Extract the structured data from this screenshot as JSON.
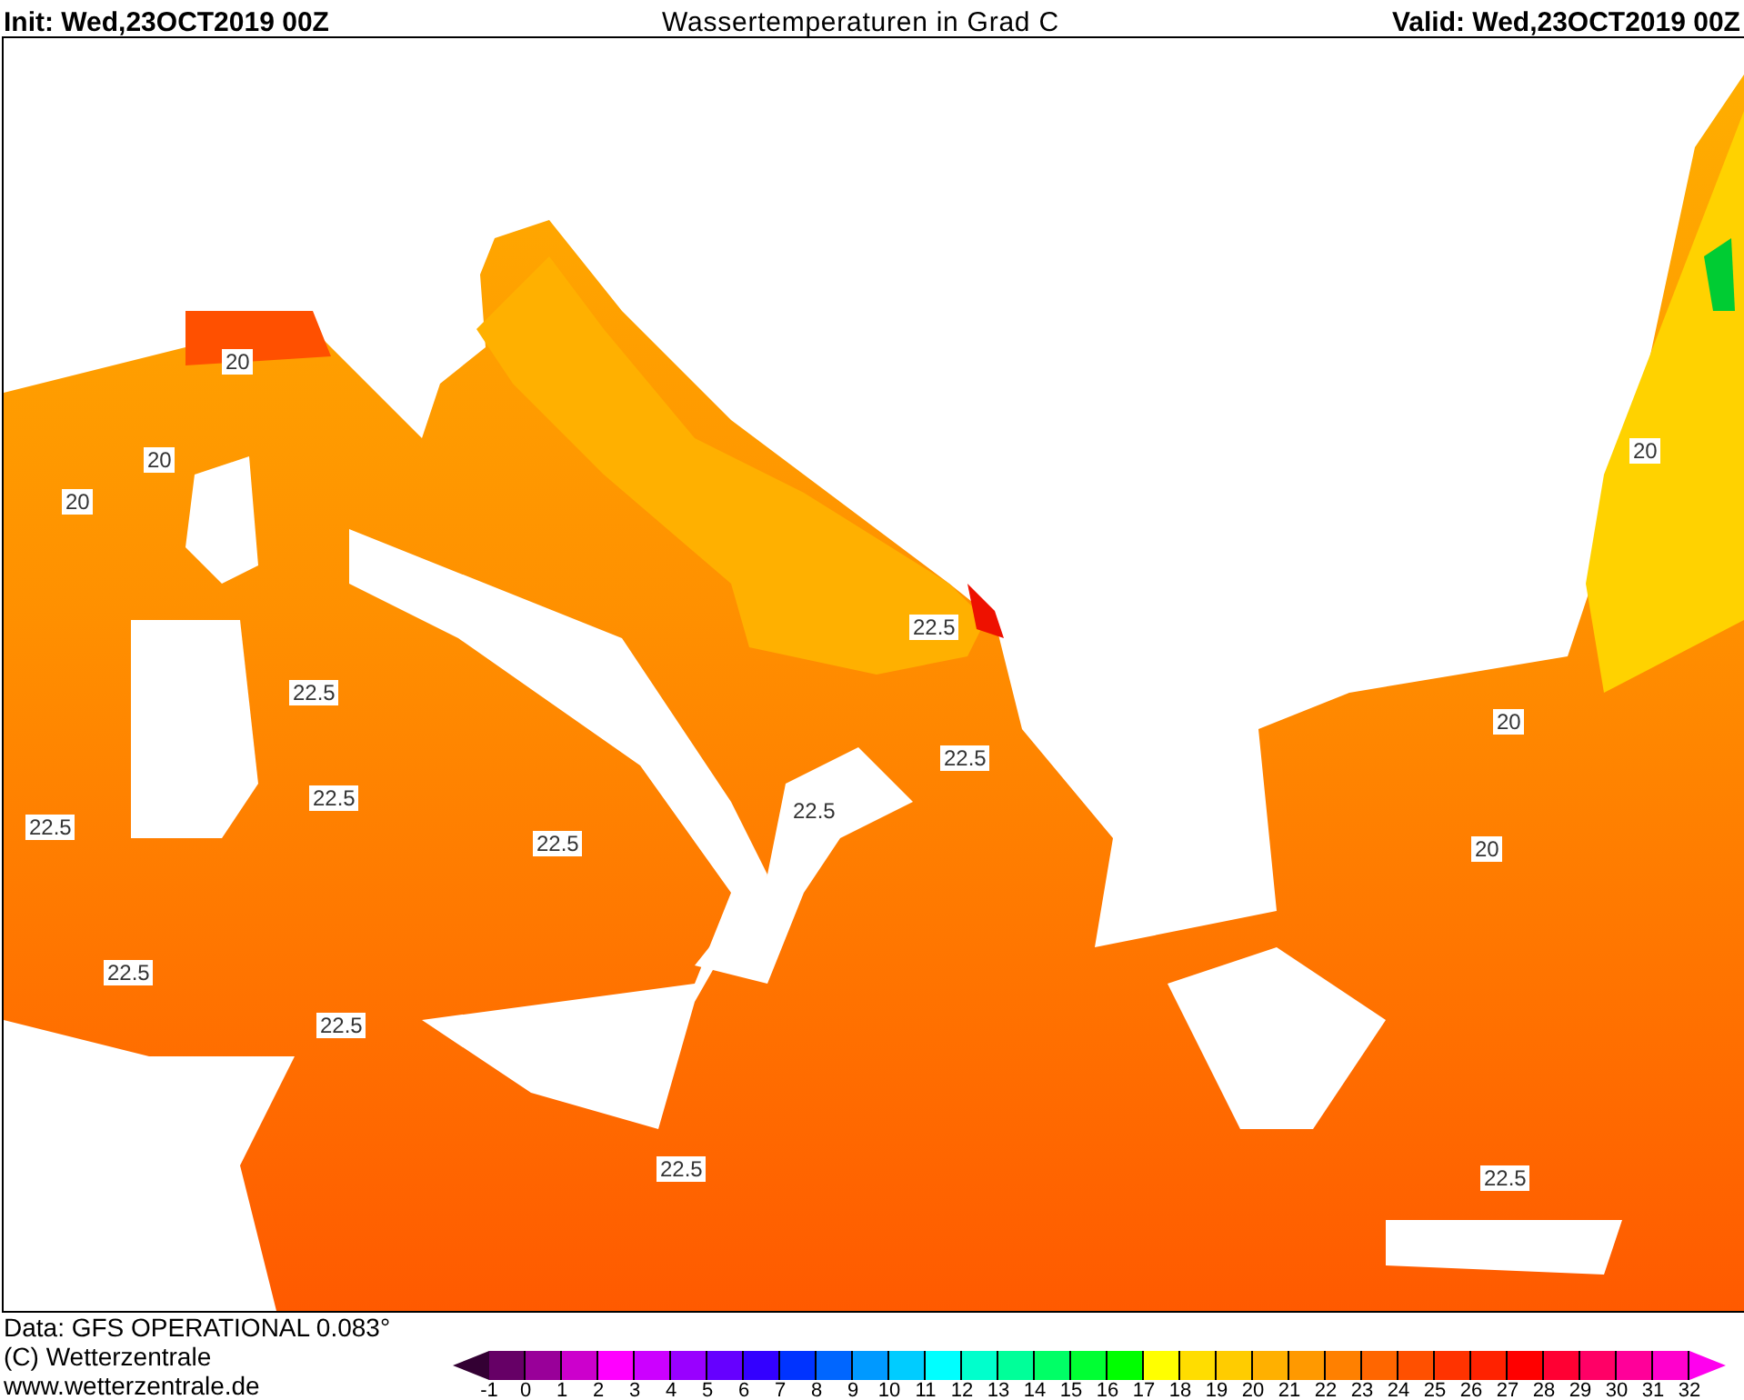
{
  "header": {
    "init": "Init: Wed,23OCT2019 00Z",
    "title": "Wassertemperaturen in Grad C",
    "valid": "Valid: Wed,23OCT2019 00Z"
  },
  "map": {
    "contour_labels": [
      "20",
      "20",
      "20",
      "22.5",
      "22.5",
      "22.5",
      "22.5",
      "22.5",
      "22.5",
      "22.5",
      "22.5",
      "22.5",
      "20",
      "20",
      "20",
      "22.5",
      "22.5"
    ]
  },
  "footer": {
    "lines": [
      "Data: GFS OPERATIONAL 0.083°",
      "(C) Wetterzentrale",
      "www.wetterzentrale.de"
    ]
  },
  "legend": {
    "low_end": {
      "color": "#330033"
    },
    "high_end": {
      "color": "#ff00ee"
    },
    "swatches": [
      {
        "color": "#660066"
      },
      {
        "color": "#990099"
      },
      {
        "color": "#cc00cc"
      },
      {
        "color": "#ff00ff"
      },
      {
        "color": "#cc00ff"
      },
      {
        "color": "#9900ff"
      },
      {
        "color": "#6600ff"
      },
      {
        "color": "#3300ff"
      },
      {
        "color": "#0033ff"
      },
      {
        "color": "#0066ff"
      },
      {
        "color": "#0099ff"
      },
      {
        "color": "#00ccff"
      },
      {
        "color": "#00ffff"
      },
      {
        "color": "#00ffcc"
      },
      {
        "color": "#00ff99"
      },
      {
        "color": "#00ff66"
      },
      {
        "color": "#00ff33"
      },
      {
        "color": "#00ff00"
      },
      {
        "color": "#ffff00"
      },
      {
        "color": "#ffdd00"
      },
      {
        "color": "#ffcc00"
      },
      {
        "color": "#ffb000"
      },
      {
        "color": "#ff9900"
      },
      {
        "color": "#ff8000"
      },
      {
        "color": "#ff6600"
      },
      {
        "color": "#ff5000"
      },
      {
        "color": "#ff3300"
      },
      {
        "color": "#ff2200"
      },
      {
        "color": "#ff0000"
      },
      {
        "color": "#ff0033"
      },
      {
        "color": "#ff0066"
      },
      {
        "color": "#ff0099"
      },
      {
        "color": "#ff00cc"
      }
    ],
    "ticks": [
      "-1",
      "0",
      "1",
      "2",
      "3",
      "4",
      "5",
      "6",
      "7",
      "8",
      "9",
      "10",
      "11",
      "12",
      "13",
      "14",
      "15",
      "16",
      "17",
      "18",
      "19",
      "20",
      "21",
      "22",
      "23",
      "24",
      "25",
      "26",
      "27",
      "28",
      "29",
      "30",
      "31",
      "32"
    ]
  }
}
